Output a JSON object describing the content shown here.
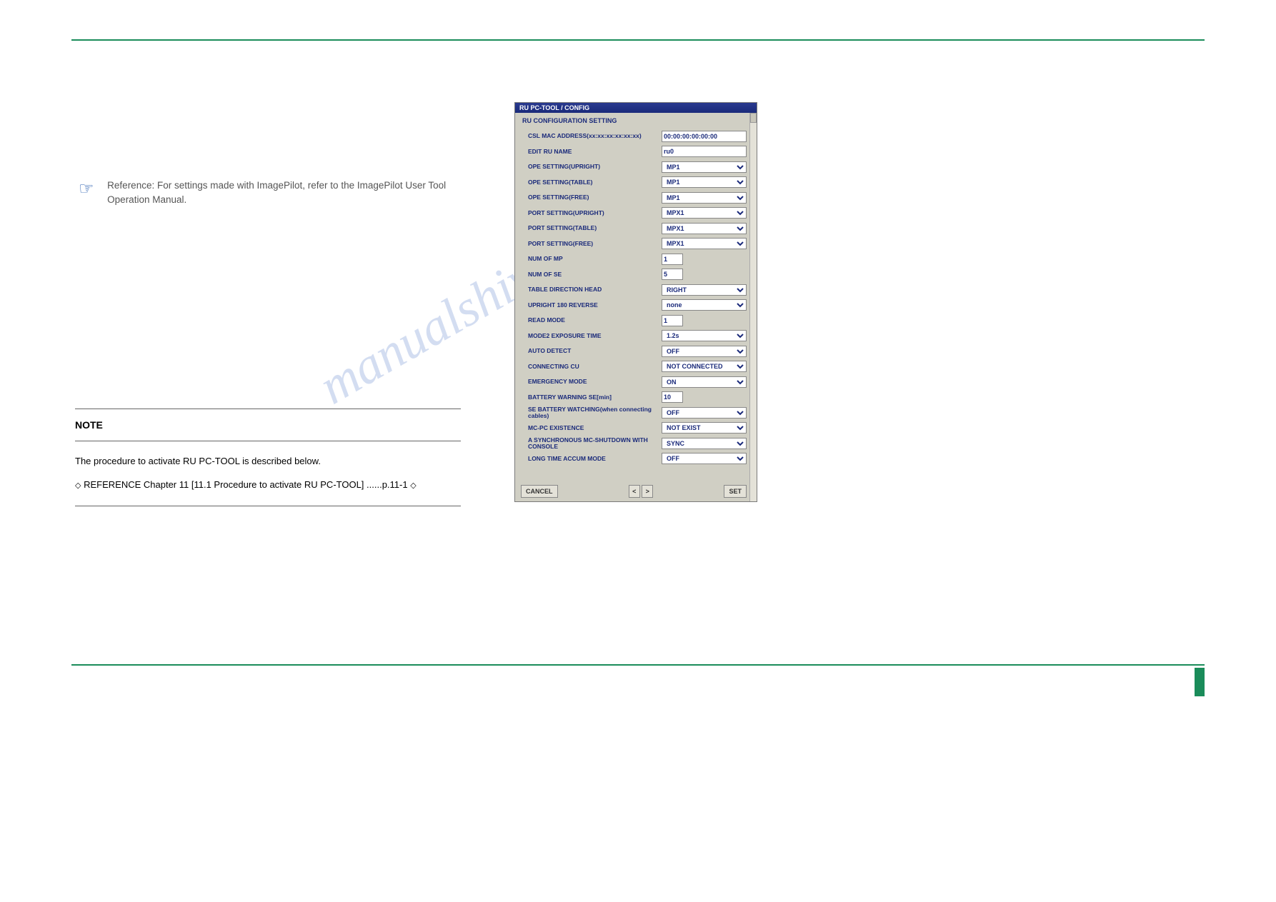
{
  "reference": "Reference: For settings made with ImagePilot, refer to the ImagePilot User Tool Operation Manual.",
  "note": {
    "title": "NOTE",
    "body_prefix": "The procedure to activate RU PC-TOOL is described below.",
    "steps": "REFERENCE    Chapter 11  [11.1 Procedure to activate RU PC-TOOL] ......p.11-1"
  },
  "dialog": {
    "title": "RU PC-TOOL / CONFIG",
    "group": "RU CONFIGURATION SETTING",
    "fields": {
      "csl_mac_label": "CSL MAC ADDRESS(xx:xx:xx:xx:xx:xx)",
      "csl_mac_value": "00:00:00:00:00:00",
      "edit_ru_label": "EDIT RU NAME",
      "edit_ru_value": "ru0",
      "ope_upright_label": "OPE SETTING(UPRIGHT)",
      "ope_upright_value": "MP1",
      "ope_table_label": "OPE SETTING(TABLE)",
      "ope_table_value": "MP1",
      "ope_free_label": "OPE SETTING(FREE)",
      "ope_free_value": "MP1",
      "port_upright_label": "PORT SETTING(UPRIGHT)",
      "port_upright_value": "MPX1",
      "port_table_label": "PORT SETTING(TABLE)",
      "port_table_value": "MPX1",
      "port_free_label": "PORT SETTING(FREE)",
      "port_free_value": "MPX1",
      "num_mp_label": "NUM OF MP",
      "num_mp_value": "1",
      "num_se_label": "NUM OF SE",
      "num_se_value": "5",
      "table_dir_label": "TABLE DIRECTION HEAD",
      "table_dir_value": "RIGHT",
      "upright180_label": "UPRIGHT 180 REVERSE",
      "upright180_value": "none",
      "read_mode_label": "READ MODE",
      "read_mode_value": "1",
      "mode2_label": "MODE2 EXPOSURE TIME",
      "mode2_value": "1.2s",
      "auto_detect_label": "AUTO DETECT",
      "auto_detect_value": "OFF",
      "conn_cu_label": "CONNECTING CU",
      "conn_cu_value": "NOT CONNECTED",
      "emerg_label": "EMERGENCY MODE",
      "emerg_value": "ON",
      "batt_warn_label": "BATTERY WARNING SE[min]",
      "batt_warn_value": "10",
      "se_batt_label": "SE BATTERY WATCHING(when connecting cables)",
      "se_batt_value": "OFF",
      "mcpc_label": "MC-PC EXISTENCE",
      "mcpc_value": "NOT EXIST",
      "sync_label": "A SYNCHRONOUS MC-SHUTDOWN WITH CONSOLE",
      "sync_value": "SYNC",
      "longtime_label": "LONG TIME ACCUM MODE",
      "longtime_value": "OFF"
    },
    "buttons": {
      "cancel": "CANCEL",
      "prev": "<",
      "next": ">",
      "set": "SET"
    }
  }
}
